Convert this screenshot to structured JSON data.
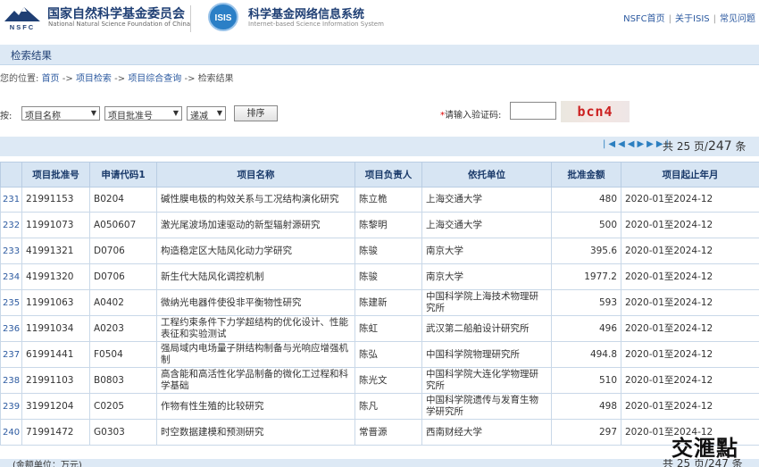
{
  "header": {
    "org_cn": "国家自然科学基金委员会",
    "org_en": "National Natural Science Foundation of China",
    "logo1_text": "NSFC",
    "logo2_text": "ISIS",
    "sys_cn": "科学基金网络信息系统",
    "sys_en": "Internet-based Science Information System",
    "links": [
      "NSFC首页",
      "关于ISIS",
      "常见问题"
    ]
  },
  "page_title": "检索结果",
  "breadcrumb": {
    "prefix": "您的位置:",
    "items": [
      "首页",
      "项目检索",
      "项目综合查询"
    ],
    "current": "检索结果",
    "sep": "->"
  },
  "filters": {
    "label": "按:",
    "field1": "项目名称",
    "field2": "项目批准号",
    "order": "递减",
    "sort_button": "排序",
    "captcha_label": "*请输入验证码:",
    "captcha_value": "",
    "captcha_text": "bcn4"
  },
  "pager": {
    "text_pre": "共 25 页/",
    "total": "247",
    "text_post": " 条",
    "icons": [
      "first-page-icon",
      "prev-page-icon",
      "next-page-icon",
      "last-page-icon"
    ]
  },
  "columns": [
    "项目批准号",
    "申请代码1",
    "项目名称",
    "项目负责人",
    "依托单位",
    "批准金额",
    "项目起止年月"
  ],
  "rows": [
    {
      "idx": "231",
      "no": "21991153",
      "code": "B0204",
      "name": "碱性膜电极的构效关系与工况结构演化研究",
      "pi": "陈立桅",
      "org": "上海交通大学",
      "amount": "480",
      "period": "2020-01至2024-12"
    },
    {
      "idx": "232",
      "no": "11991073",
      "code": "A050607",
      "name": "激光尾波场加速驱动的新型辐射源研究",
      "pi": "陈黎明",
      "org": "上海交通大学",
      "amount": "500",
      "period": "2020-01至2024-12"
    },
    {
      "idx": "233",
      "no": "41991321",
      "code": "D0706",
      "name": "构造稳定区大陆风化动力学研究",
      "pi": "陈骏",
      "org": "南京大学",
      "amount": "395.6",
      "period": "2020-01至2024-12"
    },
    {
      "idx": "234",
      "no": "41991320",
      "code": "D0706",
      "name": "新生代大陆风化调控机制",
      "pi": "陈骏",
      "org": "南京大学",
      "amount": "1977.2",
      "period": "2020-01至2024-12"
    },
    {
      "idx": "235",
      "no": "11991063",
      "code": "A0402",
      "name": "微纳光电器件使役非平衡物性研究",
      "pi": "陈建新",
      "org": "中国科学院上海技术物理研究所",
      "amount": "593",
      "period": "2020-01至2024-12"
    },
    {
      "idx": "236",
      "no": "11991034",
      "code": "A0203",
      "name": "工程约束条件下力学超结构的优化设计、性能表征和实验测试",
      "pi": "陈虹",
      "org": "武汉第二船舶设计研究所",
      "amount": "496",
      "period": "2020-01至2024-12"
    },
    {
      "idx": "237",
      "no": "61991441",
      "code": "F0504",
      "name": "强局域内电场量子阱结构制备与光响应增强机制",
      "pi": "陈弘",
      "org": "中国科学院物理研究所",
      "amount": "494.8",
      "period": "2020-01至2024-12"
    },
    {
      "idx": "238",
      "no": "21991103",
      "code": "B0803",
      "name": "高含能和高活性化学品制备的微化工过程和科学基础",
      "pi": "陈光文",
      "org": "中国科学院大连化学物理研究所",
      "amount": "510",
      "period": "2020-01至2024-12"
    },
    {
      "idx": "239",
      "no": "31991204",
      "code": "C0205",
      "name": "作物有性生殖的比较研究",
      "pi": "陈凡",
      "org": "中国科学院遗传与发育生物学研究所",
      "amount": "498",
      "period": "2020-01至2024-12"
    },
    {
      "idx": "240",
      "no": "71991472",
      "code": "G0303",
      "name": "时空数据建模和预测研究",
      "pi": "常晋源",
      "org": "西南财经大学",
      "amount": "297",
      "period": "2020-01至2024-12"
    }
  ],
  "footer": {
    "left": "(金额单位：万元)",
    "right": "共 25 页/247 条"
  },
  "watermark": "交滙點"
}
